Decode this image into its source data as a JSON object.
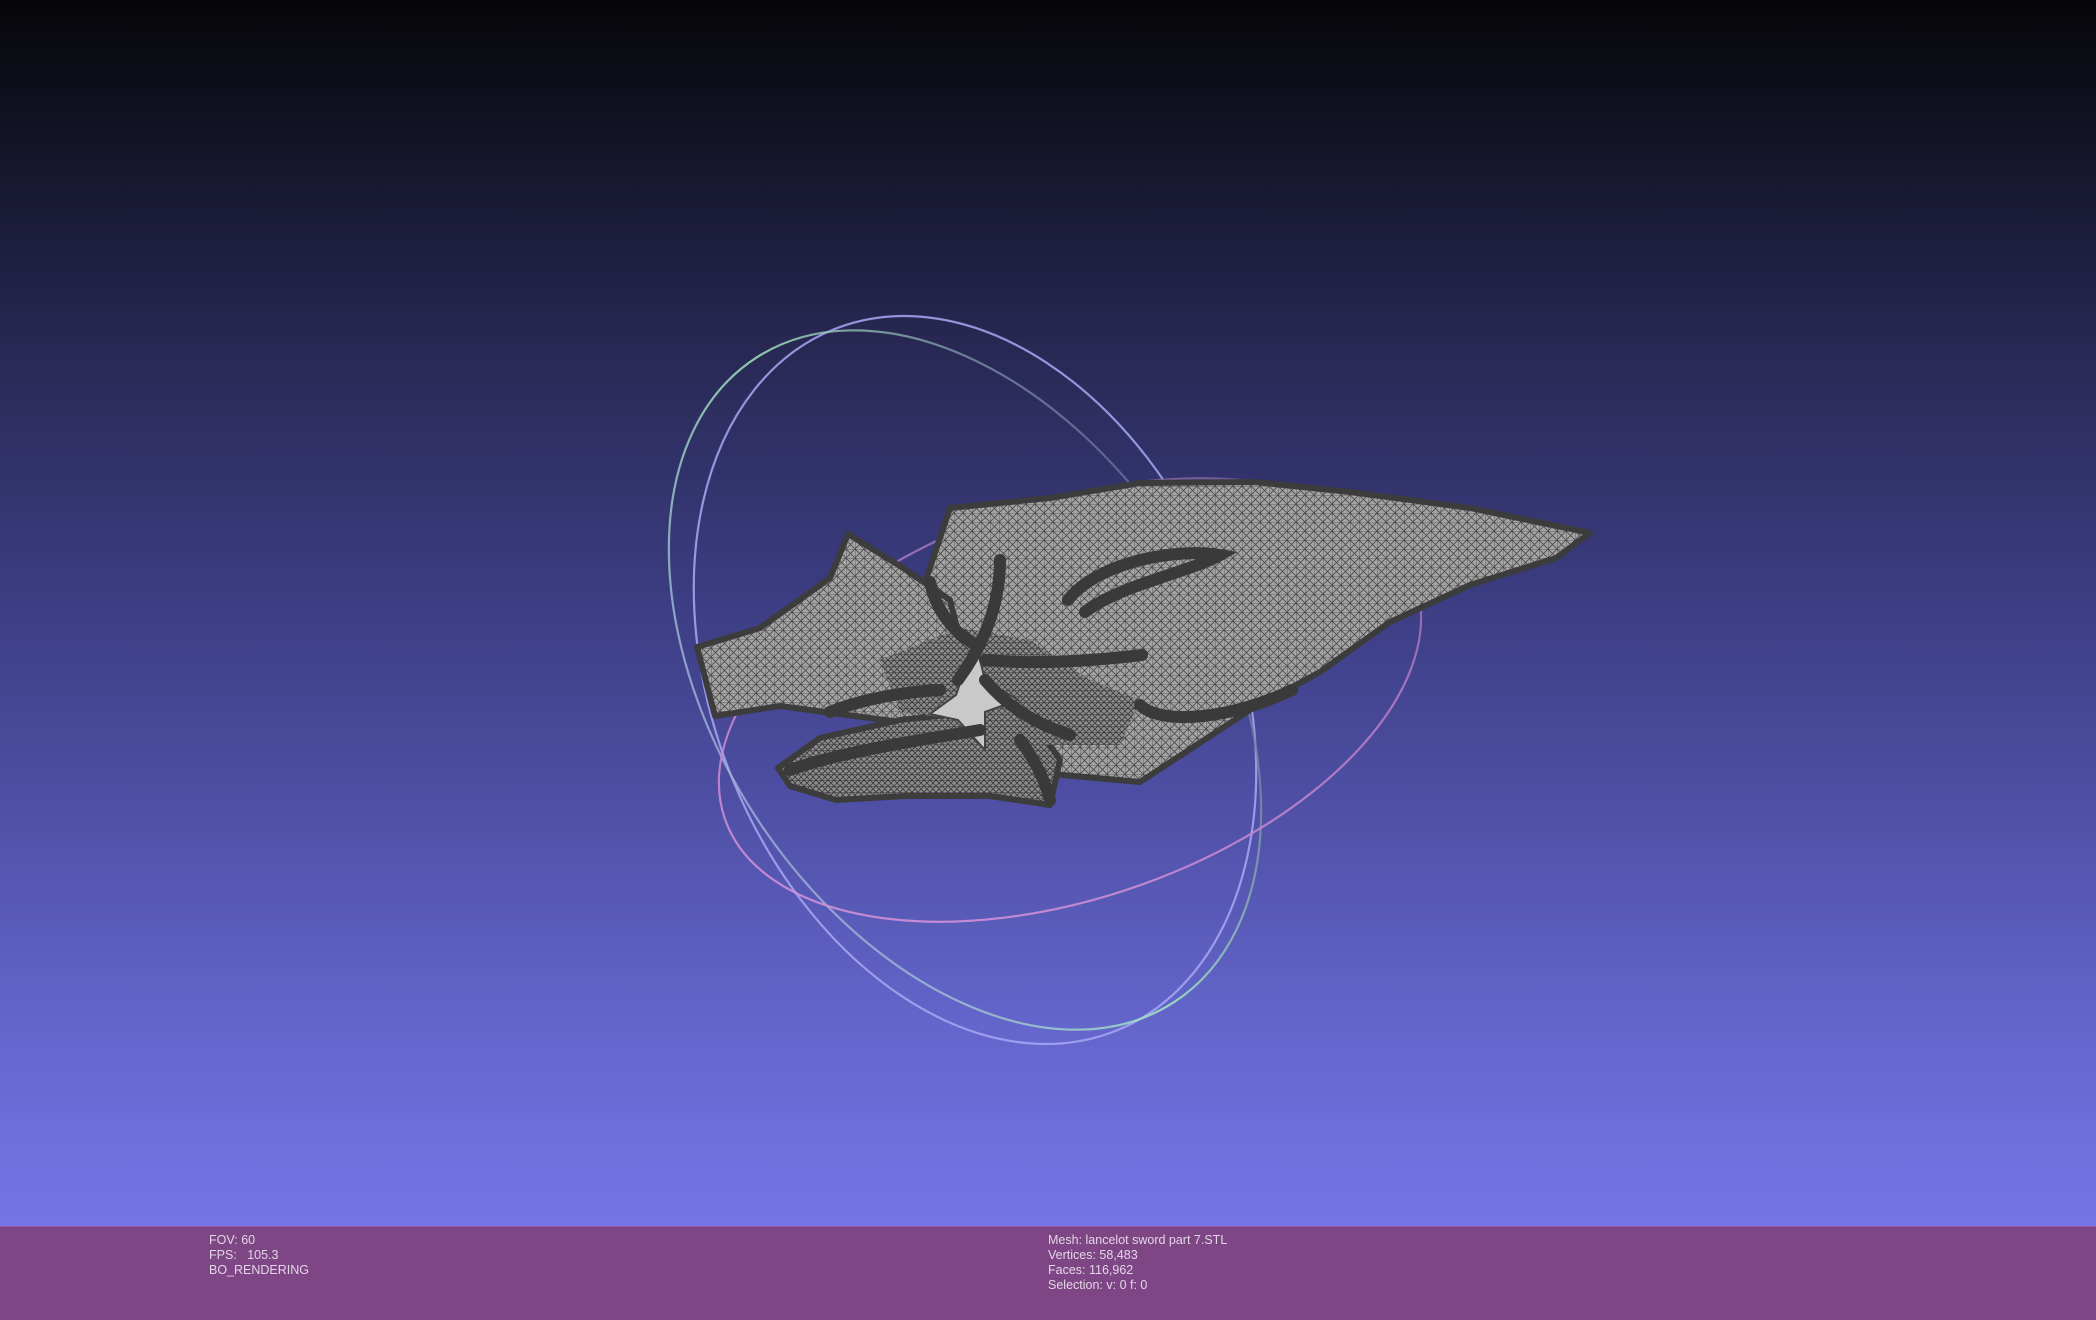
{
  "viewer": {
    "colors": {
      "background_top": "#060608",
      "background_bottom": "#7476e8",
      "status_bar": "#7e4684",
      "mesh_fill": "#a4a4a4",
      "mesh_wire": "#3c3c3c",
      "trackball_x": "#e39adf",
      "trackball_y": "#a7f0c2",
      "trackball_z": "#a8a8f5"
    }
  },
  "render_info": {
    "fov_label": "FOV:",
    "fov_value": "60",
    "fps_label": "FPS:",
    "fps_value": "105.3",
    "mode": "BO_RENDERING"
  },
  "mesh_info": {
    "mesh_label": "Mesh:",
    "mesh_name": "lancelot sword part 7.STL",
    "vertices_label": "Vertices:",
    "vertices_value": "58,483",
    "faces_label": "Faces:",
    "faces_value": "116,962",
    "selection_label": "Selection:",
    "selection_value": "v: 0 f: 0"
  }
}
